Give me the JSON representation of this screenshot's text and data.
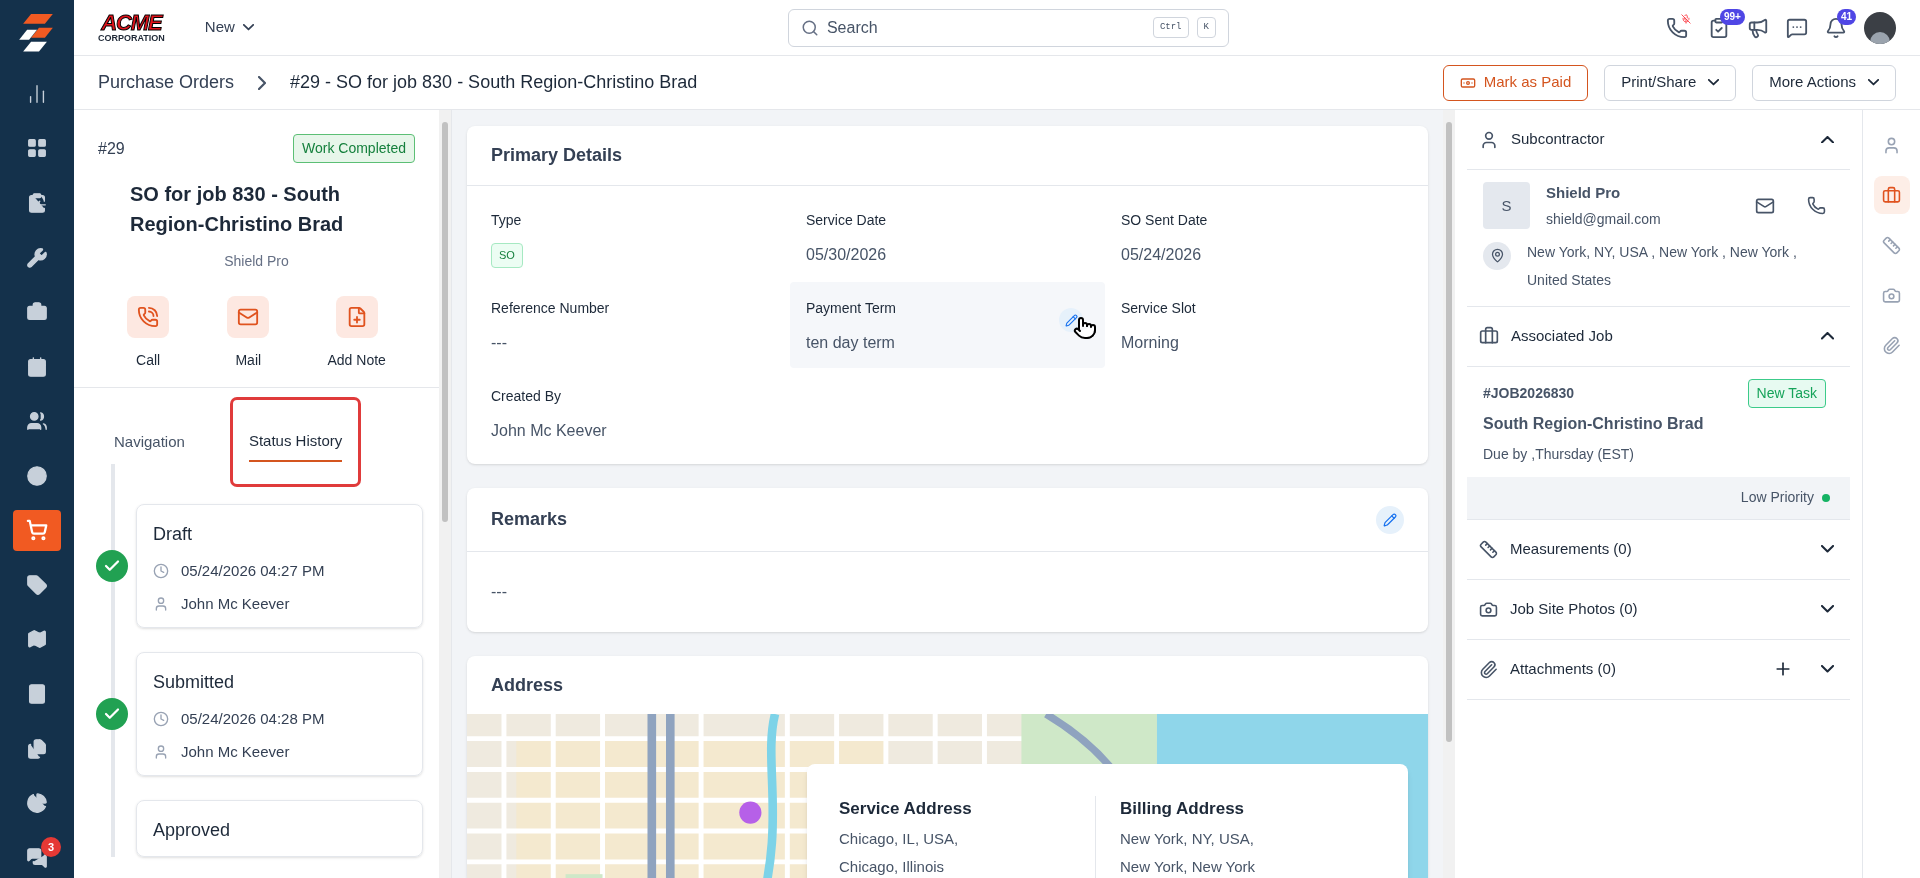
{
  "sidebar": {
    "items": [
      {
        "selected": false
      },
      {
        "selected": false
      },
      {
        "selected": false
      },
      {
        "selected": false
      },
      {
        "selected": false
      },
      {
        "selected": false
      },
      {
        "selected": false
      },
      {
        "selected": false
      },
      {
        "selected": true
      },
      {
        "selected": false
      },
      {
        "selected": false
      },
      {
        "selected": false
      },
      {
        "selected": false
      },
      {
        "selected": false
      },
      {
        "selected": false,
        "badge": "3"
      }
    ]
  },
  "header": {
    "logo": {
      "name": "ACME",
      "tagline": "CORPORATION"
    },
    "new_menu": "New",
    "search": {
      "placeholder": "Search",
      "keys": [
        "Ctrl",
        "K"
      ]
    },
    "icons": [
      {
        "kind": "call"
      },
      {
        "kind": "tasks",
        "badge": "99+"
      },
      {
        "kind": "announce"
      },
      {
        "kind": "chat"
      },
      {
        "kind": "bell",
        "badge": "41"
      },
      {
        "kind": "avatar"
      }
    ]
  },
  "breadcrumb": {
    "parent": "Purchase Orders",
    "current": "#29 - SO for job 830 - South Region-Christino Brad"
  },
  "actions": [
    {
      "kind": "primary",
      "label": "Mark as Paid"
    },
    {
      "kind": "menu",
      "label": "Print/Share"
    },
    {
      "kind": "menu",
      "label": "More Actions"
    }
  ],
  "summary": {
    "number": "#29",
    "status": "Work Completed",
    "title": "SO for job 830 - South Region-Christino Brad",
    "vendor": "Shield Pro",
    "quick_actions": [
      {
        "kind": "call",
        "label": "Call"
      },
      {
        "kind": "mail",
        "label": "Mail"
      },
      {
        "kind": "note",
        "label": "Add Note"
      }
    ]
  },
  "tabs": [
    {
      "label": "Navigation",
      "selected": false,
      "highlighted": false
    },
    {
      "label": "Status History",
      "selected": true,
      "highlighted": true
    }
  ],
  "status_history": [
    {
      "title": "Draft",
      "time": "05/24/2026 04:27 PM",
      "user": "John Mc Keever",
      "done": true
    },
    {
      "title": "Submitted",
      "time": "05/24/2026 04:28 PM",
      "user": "John Mc Keever",
      "done": true
    },
    {
      "title": "Approved"
    }
  ],
  "primary_details": {
    "title": "Primary Details",
    "fields": [
      {
        "label": "Type",
        "value": "SO",
        "kind": "tag",
        "hovered": false
      },
      {
        "label": "Service Date",
        "value": "05/30/2026",
        "kind": "text",
        "hovered": false
      },
      {
        "label": "SO Sent Date",
        "value": "05/24/2026",
        "kind": "text",
        "hovered": false
      },
      {
        "label": "Reference Number",
        "value": "---",
        "kind": "text",
        "hovered": false
      },
      {
        "label": "Payment Term",
        "value": "ten day term",
        "kind": "text",
        "hovered": true
      },
      {
        "label": "Service Slot",
        "value": "Morning",
        "kind": "text",
        "hovered": false
      },
      {
        "label": "Created By",
        "value": "John Mc Keever",
        "kind": "text",
        "hovered": false
      }
    ]
  },
  "remarks": {
    "title": "Remarks",
    "value": "---"
  },
  "address": {
    "title": "Address",
    "service": {
      "title": "Service Address",
      "lines": [
        "Chicago, IL, USA,",
        "Chicago, Illinois"
      ]
    },
    "billing": {
      "title": "Billing Address",
      "lines": [
        "New York, NY, USA,",
        "New York, New York"
      ]
    }
  },
  "subcontractor": {
    "title": "Subcontractor",
    "expanded": true,
    "initial": "S",
    "name": "Shield Pro",
    "email": "shield@gmail.com",
    "location": "New York, NY, USA , New York , New York , United States"
  },
  "associated_job": {
    "title": "Associated Job",
    "expanded": true,
    "number": "#JOB2026830",
    "status": "New Task",
    "name": "South Region-Christino Brad",
    "due": "Due by ,Thursday (EST)",
    "priority": {
      "label": "Low Priority",
      "color": "#16b364"
    }
  },
  "sections": [
    {
      "kind": "measure",
      "title": "Measurements (0)",
      "expanded": false,
      "addable": false
    },
    {
      "kind": "photos",
      "title": "Job Site Photos (0)",
      "expanded": false,
      "addable": false
    },
    {
      "kind": "files",
      "title": "Attachments (0)",
      "expanded": false,
      "addable": true
    }
  ],
  "rail": [
    {
      "selected": false
    },
    {
      "selected": true
    },
    {
      "selected": false
    },
    {
      "selected": false
    },
    {
      "selected": false
    }
  ]
}
